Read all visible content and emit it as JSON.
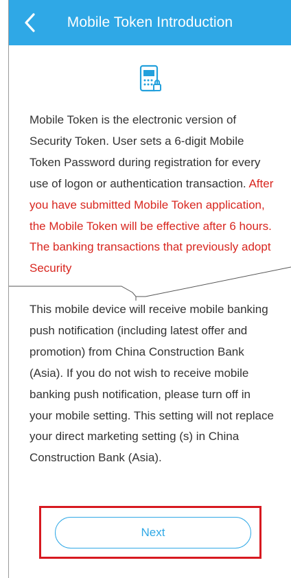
{
  "header": {
    "title": "Mobile Token Introduction",
    "back_icon": "chevron-left-icon"
  },
  "content": {
    "icon": "mobile-token-icon",
    "intro_normal": "Mobile Token is the electronic version of Security Token. User sets a 6-digit Mobile Token Password during registration for every use of logon or authentication transaction. ",
    "intro_red": "After you have submitted Mobile Token application, the Mobile Token will be effective after 6 hours. The banking transactions that previously adopt Security",
    "notice": "This mobile device will receive mobile banking push notification (including latest offer and promotion) from China Construction Bank (Asia). If you do not wish to receive mobile banking push notification, please turn off in your mobile setting. This setting will not replace your direct marketing setting (s) in China Construction Bank (Asia)."
  },
  "footer": {
    "next_label": "Next"
  },
  "colors": {
    "header": "#2fa8e6",
    "accent": "#2fa8e6",
    "warning_text": "#d8261f",
    "highlight_box": "#d71920"
  }
}
